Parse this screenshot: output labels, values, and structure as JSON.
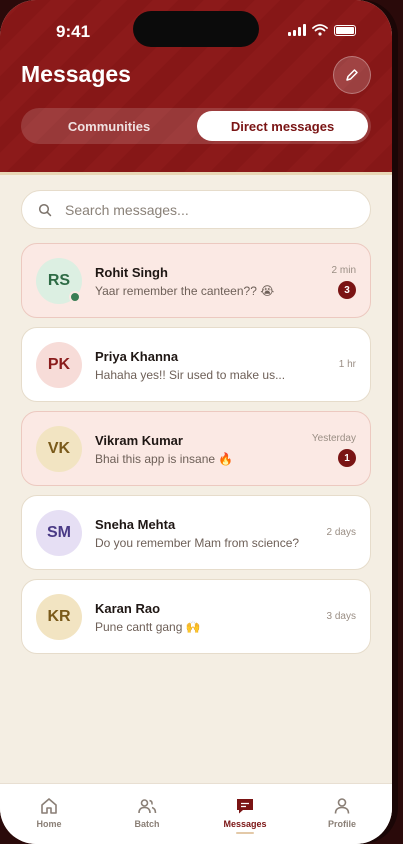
{
  "status_bar": {
    "time": "9:41"
  },
  "header": {
    "title": "Messages",
    "edit_icon": "pencil-icon",
    "tabs": [
      {
        "label": "Communities",
        "active": false
      },
      {
        "label": "Direct messages",
        "active": true
      }
    ]
  },
  "search": {
    "placeholder": "Search messages...",
    "icon": "search-icon"
  },
  "conversations": [
    {
      "initials": "RS",
      "name": "Rohit Singh",
      "preview": "Yaar remember the canteen?? 😭",
      "time": "2 min",
      "unread": "3",
      "online": true,
      "avatar_bg": "#dcefe2",
      "avatar_fg": "#2e6b45"
    },
    {
      "initials": "PK",
      "name": "Priya Khanna",
      "preview": "Hahaha yes!! Sir used to make us...",
      "time": "1 hr",
      "unread": "",
      "online": false,
      "avatar_bg": "#f7dcd8",
      "avatar_fg": "#8a1c1c"
    },
    {
      "initials": "VK",
      "name": "Vikram Kumar",
      "preview": "Bhai this app is insane 🔥",
      "time": "Yesterday",
      "unread": "1",
      "online": false,
      "avatar_bg": "#f2e4c2",
      "avatar_fg": "#7a5a1a"
    },
    {
      "initials": "SM",
      "name": "Sneha Mehta",
      "preview": "Do you remember Mam from science?",
      "time": "2 days",
      "unread": "",
      "online": false,
      "avatar_bg": "#e6dff4",
      "avatar_fg": "#4a3a86"
    },
    {
      "initials": "KR",
      "name": "Karan Rao",
      "preview": "Pune cantt gang 🙌",
      "time": "3 days",
      "unread": "",
      "online": false,
      "avatar_bg": "#f2e4c2",
      "avatar_fg": "#7a5a1a"
    }
  ],
  "tabbar": [
    {
      "label": "Home",
      "icon": "home-icon",
      "active": false
    },
    {
      "label": "Batch",
      "icon": "people-icon",
      "active": false
    },
    {
      "label": "Messages",
      "icon": "chat-bubble-icon",
      "active": true
    },
    {
      "label": "Profile",
      "icon": "person-icon",
      "active": false
    }
  ],
  "colors": {
    "brand": "#8c1a1a",
    "background": "#f4eee3",
    "unread_card": "#fbe9e4"
  }
}
